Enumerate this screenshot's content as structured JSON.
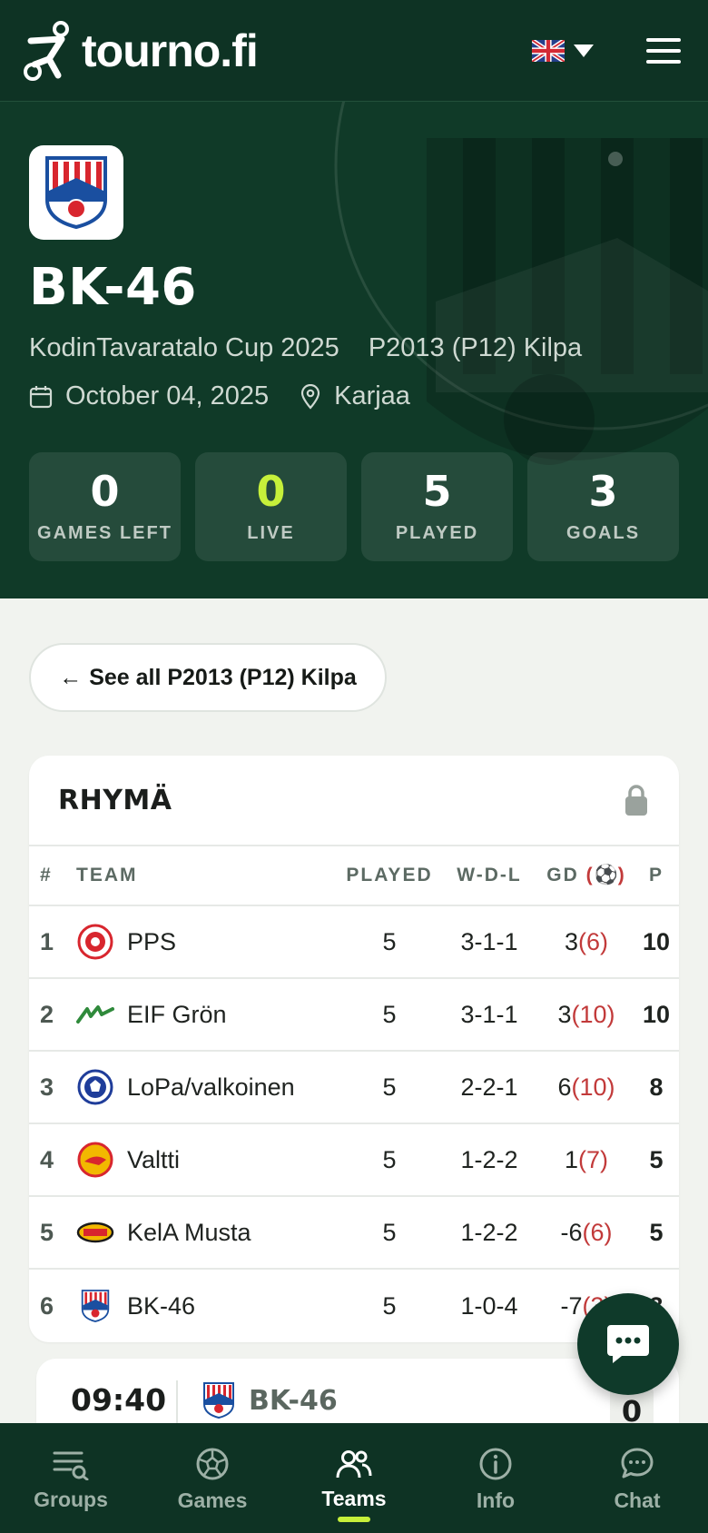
{
  "header": {
    "logo_text": "tourno.fi",
    "language_icon": "uk-flag-icon",
    "menu_icon": "hamburger-menu-icon"
  },
  "hero": {
    "team_name": "BK-46",
    "tournament": "KodinTavaratalo Cup 2025",
    "division": "P2013 (P12) Kilpa",
    "date": "October 04, 2025",
    "location": "Karjaa",
    "stats": [
      {
        "value": "0",
        "label": "GAMES LEFT"
      },
      {
        "value": "0",
        "label": "LIVE"
      },
      {
        "value": "5",
        "label": "PLAYED"
      },
      {
        "value": "3",
        "label": "GOALS"
      }
    ]
  },
  "back_button": {
    "arrow": "←",
    "label": "See all P2013 (P12) Kilpa"
  },
  "standings": {
    "title": "RHYMÄ",
    "columns": {
      "rank": "#",
      "team": "TEAM",
      "played": "PLAYED",
      "wdl": "W-D-L",
      "gd": "GD",
      "gd_icon": "⚽",
      "points": "P"
    },
    "rows": [
      {
        "rank": "1",
        "team": "PPS",
        "played": "5",
        "wdl": "3-1-1",
        "gd": "3",
        "goals": "(6)",
        "points": "10"
      },
      {
        "rank": "2",
        "team": "EIF Grön",
        "played": "5",
        "wdl": "3-1-1",
        "gd": "3",
        "goals": "(10)",
        "points": "10"
      },
      {
        "rank": "3",
        "team": "LoPa/valkoinen",
        "played": "5",
        "wdl": "2-2-1",
        "gd": "6",
        "goals": "(10)",
        "points": "8"
      },
      {
        "rank": "4",
        "team": "Valtti",
        "played": "5",
        "wdl": "1-2-2",
        "gd": "1",
        "goals": "(7)",
        "points": "5"
      },
      {
        "rank": "5",
        "team": "KelA Musta",
        "played": "5",
        "wdl": "1-2-2",
        "gd": "-6",
        "goals": "(6)",
        "points": "5"
      },
      {
        "rank": "6",
        "team": "BK-46",
        "played": "5",
        "wdl": "1-0-4",
        "gd": "-7",
        "goals": "(3)",
        "points": "3"
      }
    ]
  },
  "match": {
    "time": "09:40",
    "team": "BK-46",
    "score": "0"
  },
  "nav": {
    "items": [
      {
        "label": "Groups",
        "icon": "groups-list-icon"
      },
      {
        "label": "Games",
        "icon": "soccer-ball-icon"
      },
      {
        "label": "Teams",
        "icon": "teams-people-icon"
      },
      {
        "label": "Info",
        "icon": "info-icon"
      },
      {
        "label": "Chat",
        "icon": "chat-bubble-icon"
      }
    ],
    "active": "Teams"
  },
  "colors": {
    "header_bg": "#0e3324",
    "hero_bg": "#103a28",
    "accent_live": "#c6f03a",
    "goals_red": "#c23a3a",
    "page_bg": "#f1f3ef"
  }
}
